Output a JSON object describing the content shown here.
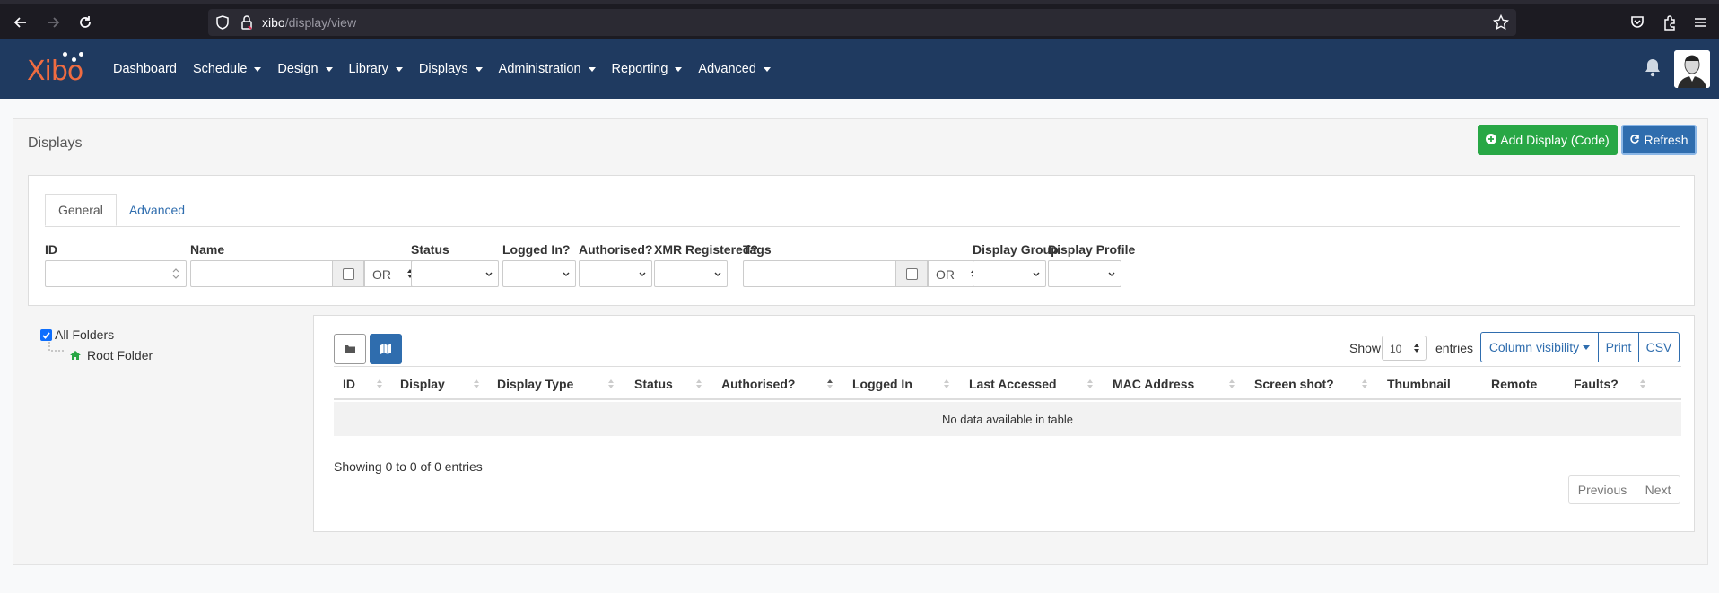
{
  "browser": {
    "url_host": "xibo",
    "url_path": "/display/view"
  },
  "navbar": {
    "logo": "Xibo",
    "menu": [
      {
        "label": "Dashboard",
        "dropdown": false
      },
      {
        "label": "Schedule",
        "dropdown": true
      },
      {
        "label": "Design",
        "dropdown": true
      },
      {
        "label": "Library",
        "dropdown": true
      },
      {
        "label": "Displays",
        "dropdown": true
      },
      {
        "label": "Administration",
        "dropdown": true
      },
      {
        "label": "Reporting",
        "dropdown": true
      },
      {
        "label": "Advanced",
        "dropdown": true
      }
    ]
  },
  "page": {
    "title": "Displays",
    "add_button": "Add Display (Code)",
    "refresh_button": "Refresh"
  },
  "filters": {
    "tabs": [
      "General",
      "Advanced"
    ],
    "labels": {
      "id": "ID",
      "name": "Name",
      "status": "Status",
      "logged_in": "Logged In?",
      "authorised": "Authorised?",
      "xmr": "XMR Registered?",
      "tags": "Tags",
      "display_group": "Display Group",
      "display_profile": "Display Profile"
    },
    "or_value": "OR"
  },
  "folders": {
    "all": "All Folders",
    "root": "Root Folder"
  },
  "table": {
    "show_label": "Show",
    "entries_label": "entries",
    "page_size": "10",
    "buttons": {
      "column_visibility": "Column visibility",
      "print": "Print",
      "csv": "CSV"
    },
    "columns": [
      "ID",
      "Display",
      "Display Type",
      "Status",
      "Authorised?",
      "Logged In",
      "Last Accessed",
      "MAC Address",
      "Screen shot?",
      "Thumbnail",
      "Remote",
      "Faults?"
    ],
    "empty_text": "No data available in table",
    "info": "Showing 0 to 0 of 0 entries",
    "pager": {
      "previous": "Previous",
      "next": "Next"
    }
  },
  "colors": {
    "navbar": "#1f3a60",
    "primary": "#2f6dae",
    "success": "#28a745",
    "logo": "#ef6c41"
  }
}
